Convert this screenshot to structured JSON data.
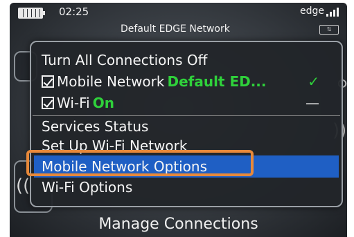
{
  "status_bar": {
    "time": "02:25",
    "network_type": "edge",
    "carrier": "Default EDGE Network",
    "battery_icon": "battery-icon",
    "signal_icon": "signal-icon"
  },
  "menu": {
    "items": [
      {
        "label": "Turn All Connections Off"
      },
      {
        "label": "Mobile Network",
        "checked": true,
        "value": "Default ED...",
        "suffix": "✓"
      },
      {
        "label": "Wi-Fi",
        "checked": true,
        "value": "On",
        "suffix": "—"
      },
      {
        "label": "Services Status"
      },
      {
        "label": "Set Up Wi-Fi Network"
      },
      {
        "label": "Mobile Network Options",
        "selected": true
      },
      {
        "label": "Wi-Fi Options"
      }
    ]
  },
  "footer": {
    "title": "Manage Connections"
  },
  "colors": {
    "selection": "#1f5fc4",
    "status_on": "#2fd13b",
    "highlight_outline": "#e8893a"
  }
}
